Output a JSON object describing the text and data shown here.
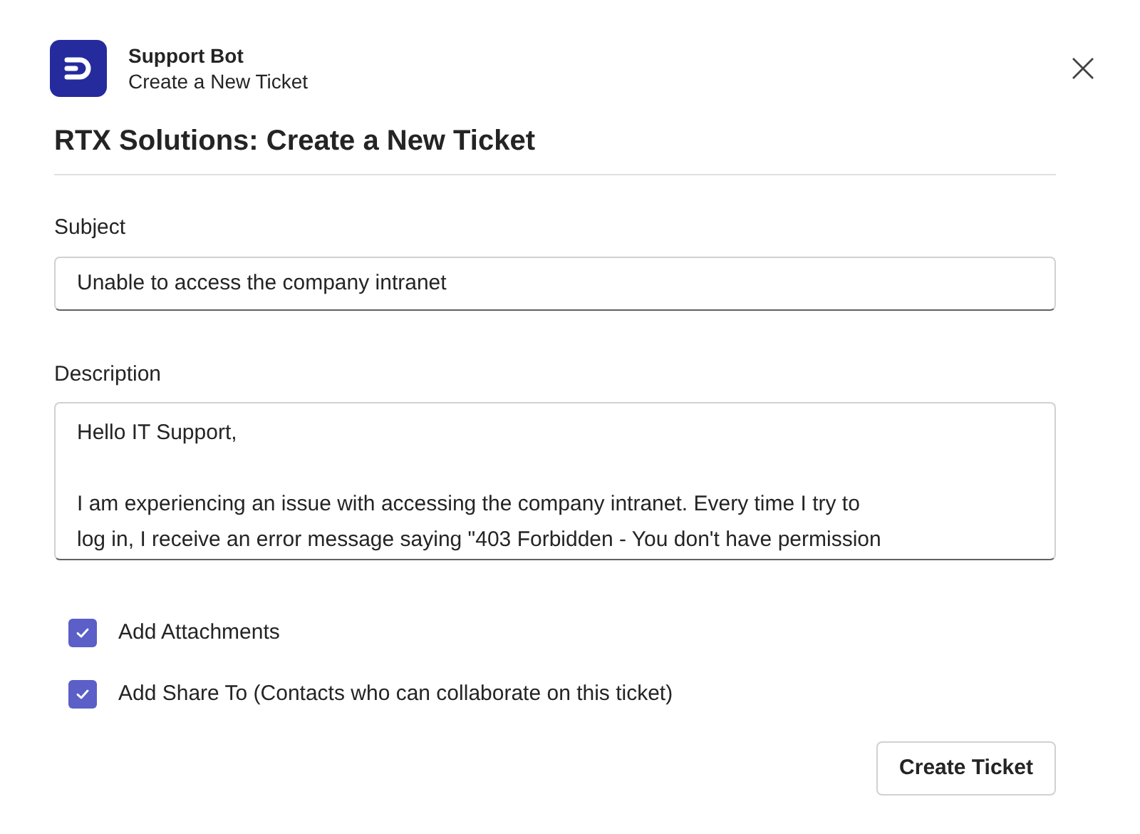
{
  "header": {
    "app_name": "Support Bot",
    "subtitle": "Create a New Ticket"
  },
  "form": {
    "title": "RTX Solutions: Create a New Ticket",
    "subject": {
      "label": "Subject",
      "value": "Unable to access the company intranet"
    },
    "description": {
      "label": "Description",
      "value": "Hello IT Support,\n\nI am experiencing an issue with accessing the company intranet. Every time I try to\nlog in, I receive an error message saying \"403 Forbidden - You don't have permission"
    },
    "options": [
      {
        "label": "Add Attachments",
        "checked": true
      },
      {
        "label": "Add Share To (Contacts who can collaborate on this ticket)",
        "checked": true
      }
    ],
    "submit": "Create Ticket"
  }
}
